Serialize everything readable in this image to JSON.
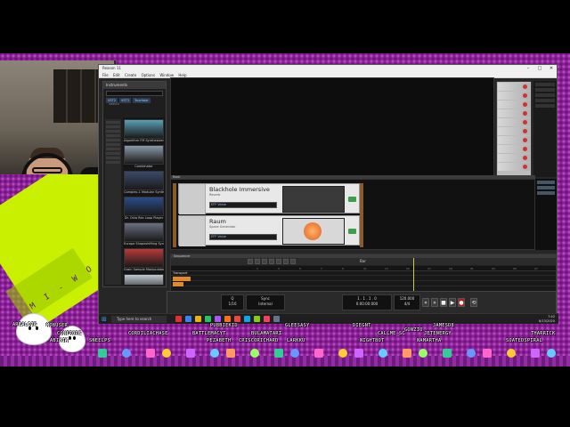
{
  "window": {
    "title": "Reason 11",
    "menu": [
      "File",
      "Edit",
      "Create",
      "Options",
      "Window",
      "Help"
    ],
    "controls": {
      "minimize": "–",
      "maximize": "□",
      "close": "✕"
    }
  },
  "browser": {
    "header": "Instruments",
    "search_placeholder": "Search",
    "tabs": [
      "VST2",
      "VST3",
      "Touchbar"
    ],
    "items": [
      {
        "label": "Algorithm FM Synthesizer",
        "color": "#5aa0b4"
      },
      {
        "label": "Combinator",
        "color": "#8a9aa8"
      },
      {
        "label": "Complex-1 Modular Synthesizer",
        "color": "#3a4a6a"
      },
      {
        "label": "Dr. Octo Rex Loop Player",
        "color": "#2a4c8a"
      },
      {
        "label": "Europa Shapeshifting Synthesizer",
        "color": "#6a7080"
      },
      {
        "label": "Grain Sample Manipulator",
        "color": "#b83a3a"
      },
      {
        "label": "Friktion Modeled Strings",
        "color": "#c0c8d0"
      },
      {
        "label": "Kong Drum Designer",
        "color": "#4a6a9a"
      }
    ]
  },
  "panes": {
    "rack_top": "Main",
    "rack_mid": "Rack",
    "sequencer": "Sequencer"
  },
  "devices": [
    {
      "name": "Blackhole Immersive",
      "sub": "Reverb",
      "lcd": "EFF  Value"
    },
    {
      "name": "Raum",
      "sub": "Space Generator",
      "lcd": "EFF  Value"
    }
  ],
  "sequencer": {
    "tool_label": "Bar",
    "track": "Transport",
    "ruler": [
      "1",
      "3",
      "5",
      "7",
      "9",
      "11",
      "13",
      "15",
      "17",
      "19",
      "21",
      "23",
      "25",
      "27"
    ]
  },
  "transport": {
    "quantize": "1/16",
    "quantize_label": "Q",
    "sync": "Internal",
    "sync_label": "Sync",
    "position": "1 . 1 . 1 . 0",
    "time": "0:00:00:000",
    "tempo": "120.000",
    "signature": "4/4",
    "buttons": {
      "rewind": "«",
      "forward": "»",
      "stop": "■",
      "play": "▶",
      "record": "●",
      "loop": "⟲"
    }
  },
  "taskbar": {
    "search": "Type here to search",
    "clock_time": "7:42",
    "clock_date": "6/13/2020",
    "apps": [
      "#e03030",
      "#3b82f6",
      "#eab308",
      "#22c55e",
      "#a855f7",
      "#f97316",
      "#ef4444",
      "#0ea5e9",
      "#84cc16",
      "#f43f5e",
      "#64748b"
    ]
  },
  "overlay": {
    "brand": "M I - W O",
    "chatters": [
      "AREALIZE",
      "MOBUSER",
      "SNEELPS",
      "CORDILIACHASE",
      "BATTLEMACYT",
      "PUBBIEKID",
      "BULAMATARI",
      "PEZABETH",
      "CRISCORICHARD",
      "LARKKU",
      "GLEESASY",
      "DIEGNT",
      "CALLME_SC",
      "GONZIO",
      "JAMESD8",
      "NIGHTBOT",
      "NAMARTHA",
      "JETENERGY",
      "THARRICK",
      "SOATEDSPIRAL",
      "CONFRORE",
      "ABIKIN"
    ]
  }
}
